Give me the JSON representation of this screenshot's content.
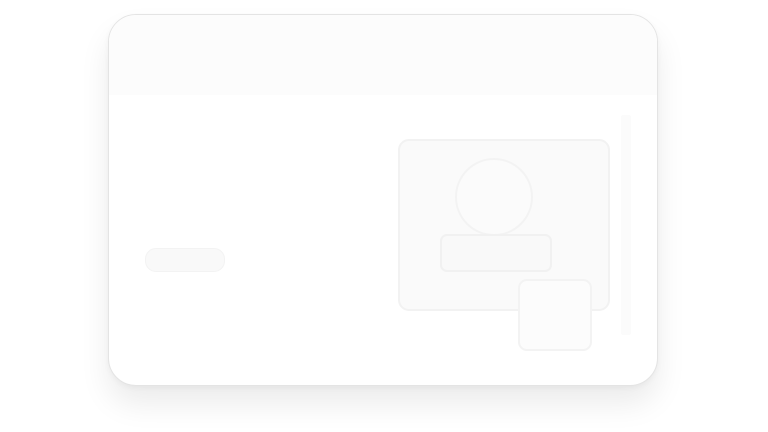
{
  "window": {
    "header": {},
    "hero": {
      "title": "",
      "button_label": "",
      "graphic": "faint-illustration"
    }
  }
}
